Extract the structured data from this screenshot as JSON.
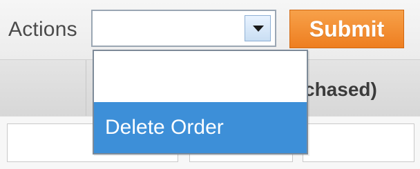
{
  "toolbar": {
    "actions_label": "Actions",
    "select_value": "",
    "submit_label": "Submit"
  },
  "header": {
    "column_partial": "chased)"
  },
  "dropdown": {
    "options": [
      "",
      "Delete Order"
    ],
    "selected_index": 1
  },
  "colors": {
    "submit_button": "#ee7e20",
    "selected_option": "#3d8fd8"
  },
  "icons": {
    "select_arrow": "chevron-down-icon"
  }
}
